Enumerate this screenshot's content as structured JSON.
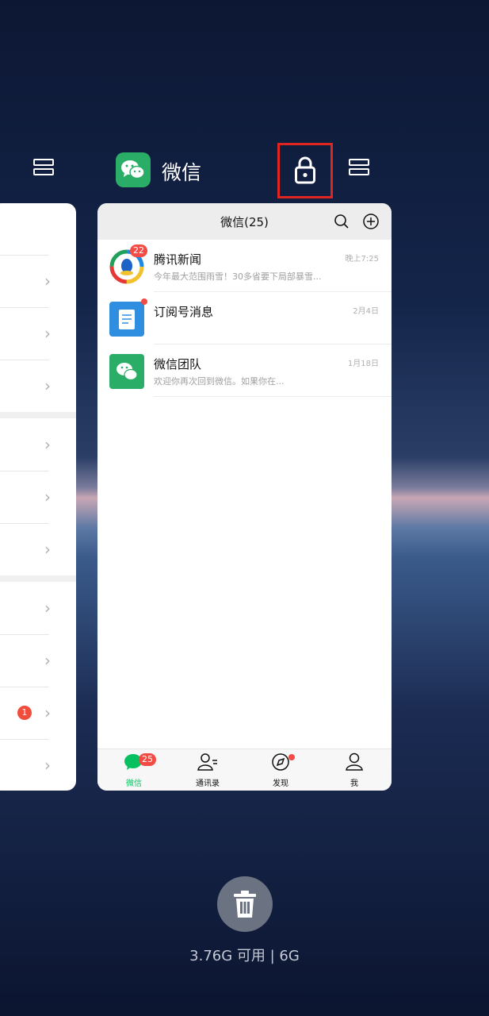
{
  "app": {
    "name": "微信"
  },
  "left_card": {
    "badge": "1"
  },
  "card": {
    "title": "微信(25)",
    "chats": [
      {
        "name": "腾讯新闻",
        "preview": "今年最大范围雨雪！30多省要下局部暴雪...",
        "time": "晚上7:25",
        "badge": "22"
      },
      {
        "name": "订阅号消息",
        "preview": "",
        "time": "2月4日"
      },
      {
        "name": "微信团队",
        "preview": "欢迎你再次回到微信。如果你在...",
        "time": "1月18日"
      }
    ],
    "tabs": [
      {
        "label": "微信",
        "badge": "25"
      },
      {
        "label": "通讯录"
      },
      {
        "label": "发现"
      },
      {
        "label": "我"
      }
    ]
  },
  "memory": "3.76G 可用 | 6G",
  "colors": {
    "wechat_green": "#07c160",
    "lock_highlight": "#e0241f",
    "badge_red": "#f24c45"
  }
}
